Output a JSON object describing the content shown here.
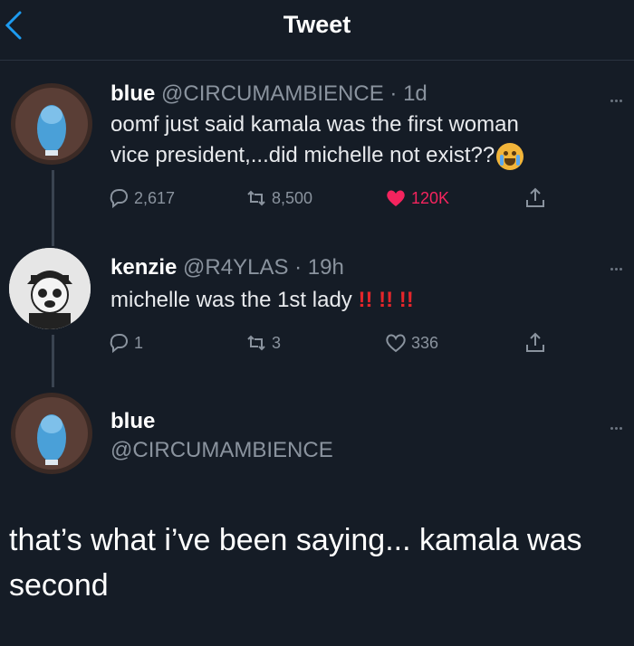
{
  "header": {
    "title": "Tweet"
  },
  "tweets": [
    {
      "name": "blue",
      "handle": "@CIRCUMAMBIENCE",
      "time": "· 1d",
      "text_line1": "oomf just said kamala was the first woman",
      "text_line2": "vice president,...did michelle not exist??",
      "emoji": "loudly-crying-face",
      "replies": "2,617",
      "retweets": "8,500",
      "likes": "120K",
      "liked": true
    },
    {
      "name": "kenzie",
      "handle": "@R4YLAS",
      "time": "· 19h",
      "text": "michelle was the 1st lady",
      "bangs": "!! !! !!",
      "replies": "1",
      "retweets": "3",
      "likes": "336",
      "liked": false
    }
  ],
  "main_tweet": {
    "name": "blue",
    "handle": "@CIRCUMAMBIENCE",
    "text": "that’s what i’ve been saying... kamala was second"
  },
  "colors": {
    "background": "#151c26",
    "like_active": "#f4245e",
    "muted": "#8a939e",
    "accent_blue": "#1d9bf0"
  }
}
